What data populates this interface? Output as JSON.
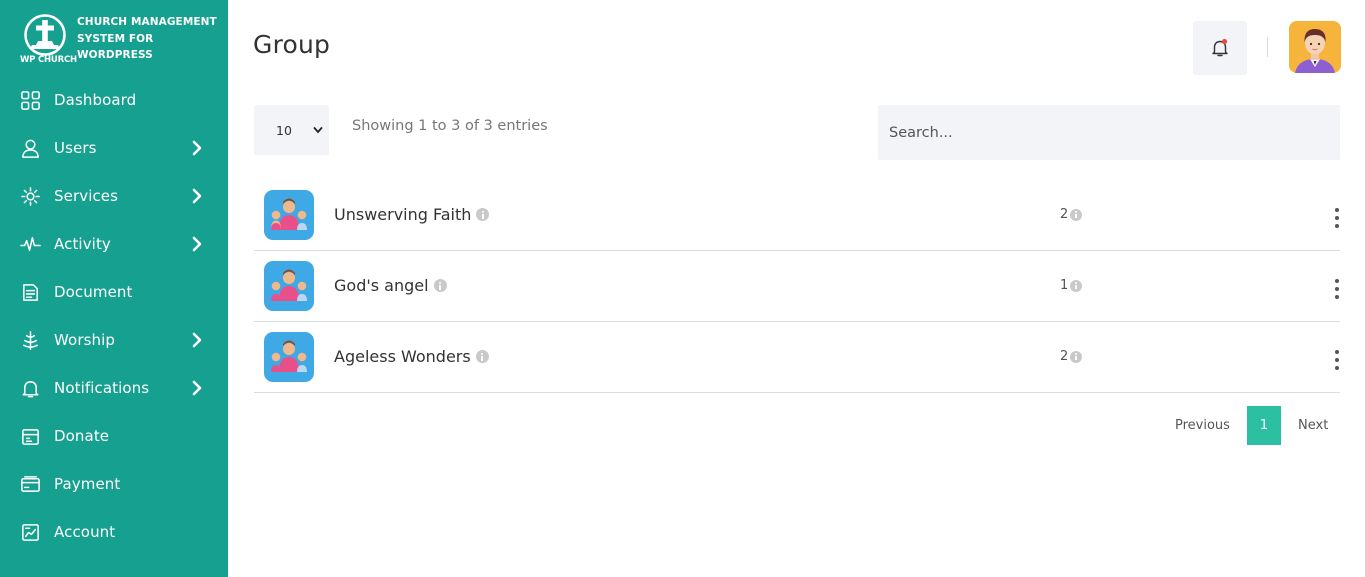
{
  "brand": {
    "title": "Church Management System for WordPress",
    "subtitle": "WP CHURCH",
    "logo_icon": "church-cross-icon"
  },
  "sidebar": {
    "items": [
      {
        "label": "Dashboard",
        "icon": "dashboard-icon",
        "has_submenu": false
      },
      {
        "label": "Users",
        "icon": "user-icon",
        "has_submenu": true
      },
      {
        "label": "Services",
        "icon": "services-icon",
        "has_submenu": true
      },
      {
        "label": "Activity",
        "icon": "activity-icon",
        "has_submenu": true
      },
      {
        "label": "Document",
        "icon": "document-icon",
        "has_submenu": false
      },
      {
        "label": "Worship",
        "icon": "worship-icon",
        "has_submenu": true
      },
      {
        "label": "Notifications",
        "icon": "bell-icon",
        "has_submenu": true
      },
      {
        "label": "Donate",
        "icon": "donate-icon",
        "has_submenu": false
      },
      {
        "label": "Payment",
        "icon": "payment-icon",
        "has_submenu": false
      },
      {
        "label": "Account",
        "icon": "account-icon",
        "has_submenu": false
      }
    ]
  },
  "header": {
    "title": "Group",
    "notification_icon": "bell-icon",
    "avatar_icon": "user-avatar"
  },
  "table_controls": {
    "page_length": "10",
    "page_length_options": [
      "10"
    ],
    "entries_info": "Showing 1 to 3 of 3 entries",
    "search_placeholder": "Search..."
  },
  "groups": [
    {
      "name": "Unswerving Faith",
      "count": "2"
    },
    {
      "name": "God's angel",
      "count": "1"
    },
    {
      "name": "Ageless Wonders",
      "count": "2"
    }
  ],
  "pagination": {
    "previous": "Previous",
    "current": "1",
    "next": "Next"
  },
  "colors": {
    "sidebar": "#16a090",
    "accent": "#2dbfa2",
    "group_icon_bg": "#3fa9e6",
    "avatar_bg": "#f6b43c",
    "notification_dot": "#e74c3c"
  }
}
